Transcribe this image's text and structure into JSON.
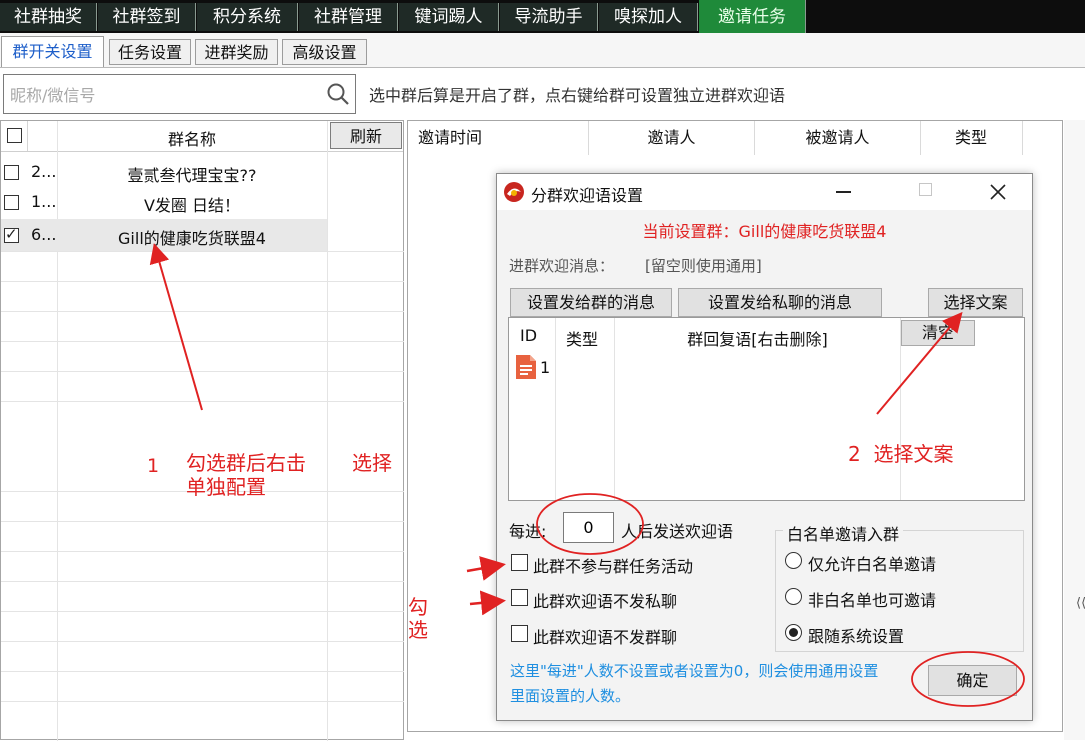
{
  "top_tabs": [
    "社群抽奖",
    "社群签到",
    "积分系统",
    "社群管理",
    "键词踢人",
    "导流助手",
    "嗅探加人",
    "邀请任务"
  ],
  "sub_tabs": [
    "群开关设置",
    "任务设置",
    "进群奖励",
    "高级设置"
  ],
  "search": {
    "placeholder": "昵称/微信号"
  },
  "hint_text": "选中群后算是开启了群，点右键给群可设置独立进群欢迎语",
  "group_table": {
    "col_name": "群名称",
    "refresh_label": "刷新",
    "rows": [
      {
        "id": "2...",
        "name": "壹贰叁代理宝宝??",
        "checked": false
      },
      {
        "id": "1...",
        "name": "V发圈 日结！",
        "checked": false
      },
      {
        "id": "6...",
        "name": "Gill的健康吃货联盟4",
        "checked": true
      }
    ]
  },
  "invite_table": {
    "headers": [
      "邀请时间",
      "邀请人",
      "被邀请人",
      "类型"
    ]
  },
  "dialog": {
    "title": "分群欢迎语设置",
    "current_group": "当前设置群：Gill的健康吃货联盟4",
    "welcome_label": "进群欢迎消息：",
    "welcome_note": "[留空则使用通用]",
    "btn_group_msg": "设置发给群的消息",
    "btn_private_msg": "设置发给私聊的消息",
    "btn_select_copy": "选择文案",
    "table_headers": {
      "id": "ID",
      "type": "类型",
      "reply": "群回复语[右击删除]"
    },
    "clear_label": "清空",
    "row_id": "1",
    "every_prefix": "每进:",
    "every_value": "0",
    "every_suffix": "人后发送欢迎语",
    "checkboxes": [
      "此群不参与群任务活动",
      "此群欢迎语不发私聊",
      "此群欢迎语不发群聊"
    ],
    "whitelist": {
      "title": "白名单邀请入群",
      "options": [
        "仅允许白名单邀请",
        "非白名单也可邀请",
        "跟随系统设置"
      ],
      "selected": 2
    },
    "note": "这里\"每进\"人数不设置或者设置为0，则会使用通用设置里面设置的人数。",
    "ok_label": "确定"
  },
  "annotations": {
    "step1_num": "1",
    "step1_text": "勾选群后右击",
    "step1_text2": "单独配置",
    "step1_select": "选择",
    "step2_text": "2  选择文案",
    "check_text_1": "勾",
    "check_text_2": "选"
  },
  "colors": {
    "accent_tab": "#1f8a3a",
    "annotation_red": "#e02222",
    "note_blue": "#1f8fe0"
  }
}
